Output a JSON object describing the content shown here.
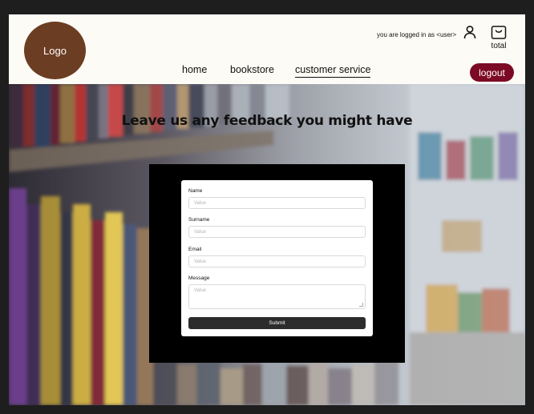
{
  "header": {
    "logo": "Logo",
    "user_note": "you are logged in as <user>",
    "cart_label": "total",
    "nav": {
      "home": "home",
      "bookstore": "bookstore",
      "customer_service": "customer service"
    },
    "logout": "logout"
  },
  "hero": {
    "title": "Leave us any feedback you might have"
  },
  "form": {
    "fields": [
      {
        "label": "Name",
        "placeholder": "Value"
      },
      {
        "label": "Surname",
        "placeholder": "Value"
      },
      {
        "label": "Email",
        "placeholder": "Value"
      },
      {
        "label": "Message",
        "placeholder": "Value"
      }
    ],
    "submit": "Submit"
  },
  "colors": {
    "header_bg": "#fdfbf5",
    "logo_bg": "#6b3d22",
    "logout_bg": "#7c0a24",
    "submit_bg": "#2c2c2c"
  },
  "icons": [
    "user-icon",
    "shopping-bag-icon"
  ]
}
